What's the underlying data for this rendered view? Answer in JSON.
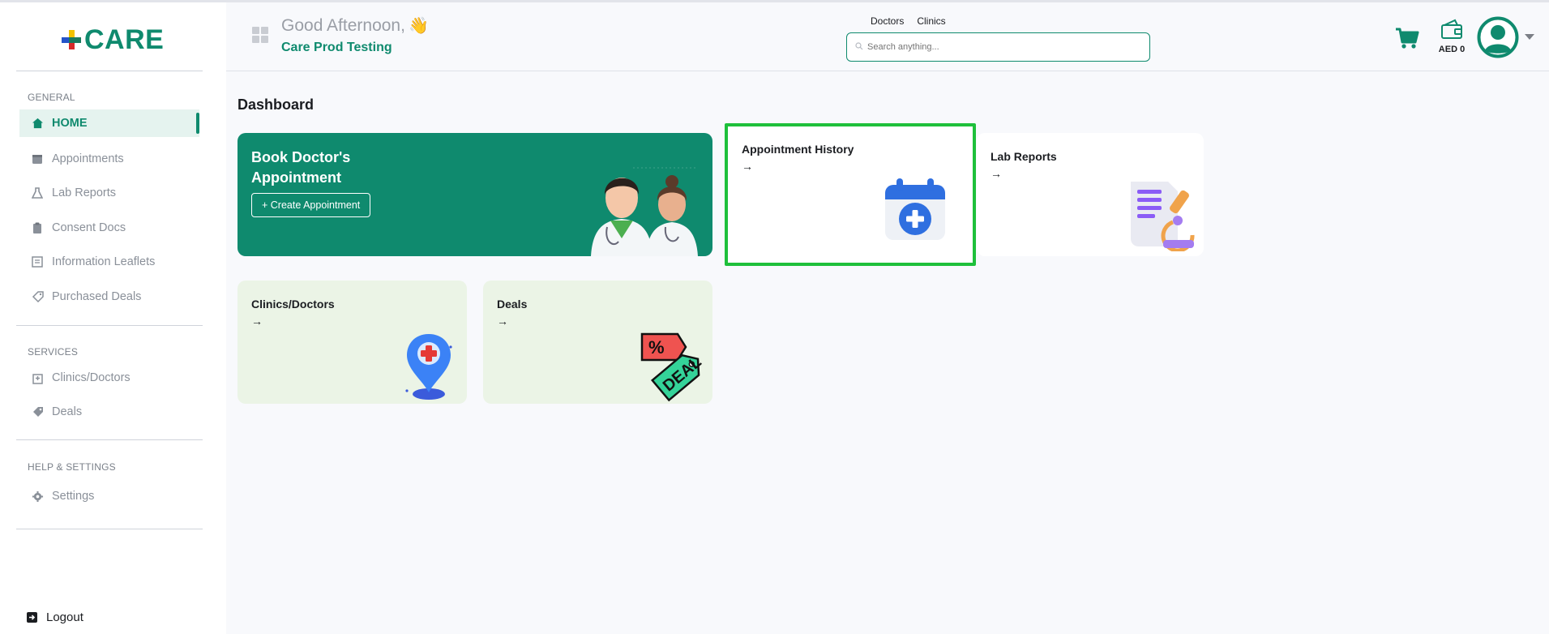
{
  "app": {
    "logo_text": "CARE"
  },
  "sidebar": {
    "sections": [
      {
        "title": "GENERAL"
      },
      {
        "title": "SERVICES"
      },
      {
        "title": "HELP & SETTINGS"
      }
    ],
    "general_items": [
      {
        "label": "HOME",
        "icon": "home-icon",
        "active": true
      },
      {
        "label": "Appointments",
        "icon": "calendar-icon"
      },
      {
        "label": "Lab Reports",
        "icon": "flask-icon"
      },
      {
        "label": "Consent Docs",
        "icon": "clipboard-icon"
      },
      {
        "label": "Information Leaflets",
        "icon": "leaflet-icon"
      },
      {
        "label": "Purchased Deals",
        "icon": "deal-icon"
      }
    ],
    "services_items": [
      {
        "label": "Clinics/Doctors",
        "icon": "hospital-icon"
      },
      {
        "label": "Deals",
        "icon": "tag-icon"
      }
    ],
    "settings_items": [
      {
        "label": "Settings",
        "icon": "gear-icon"
      }
    ],
    "logout_label": "Logout"
  },
  "header": {
    "greeting": "Good Afternoon,",
    "user_name": "Care Prod Testing",
    "search_tabs": [
      "Doctors",
      "Clinics"
    ],
    "search_placeholder": "Search anything...",
    "wallet_label": "AED 0"
  },
  "main": {
    "title": "Dashboard",
    "book_card": {
      "title": "Book Doctor's Appointment",
      "button_label": "+ Create Appointment"
    },
    "cards": [
      {
        "title": "Appointment History",
        "arrow": "→",
        "icon": "calendar-plus-icon",
        "highlighted": true
      },
      {
        "title": "Lab Reports",
        "arrow": "→",
        "icon": "microscope-report-icon"
      },
      {
        "title": "Clinics/Doctors",
        "arrow": "→",
        "icon": "map-pin-medical-icon"
      },
      {
        "title": "Deals",
        "arrow": "→",
        "icon": "deal-tag-icon"
      }
    ]
  },
  "colors": {
    "brand": "#0f8a6e",
    "highlight": "#1ec03b",
    "card_light": "#ebf4e6"
  }
}
